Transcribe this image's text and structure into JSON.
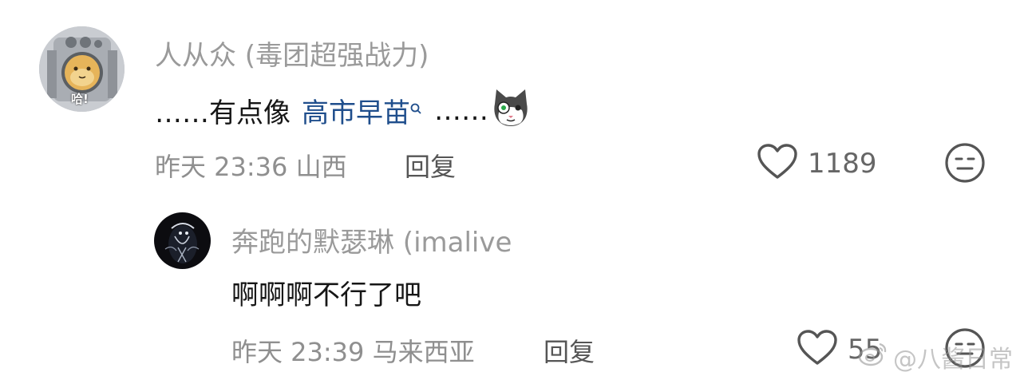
{
  "comment": {
    "username": "人从众 (毒团超强战力)",
    "text_prefix": "……有点像",
    "mention": "高市早苗",
    "text_suffix": "……",
    "avatar_overlay_text": "哈!",
    "time": "昨天 23:36",
    "location": "山西",
    "reply_label": "回复",
    "like_count": "1189"
  },
  "reply": {
    "username": "奔跑的默瑟琳 (imalive",
    "text": "啊啊啊不行了吧",
    "time": "昨天 23:39",
    "location": "马来西亚",
    "reply_label": "回复",
    "like_count": "55"
  },
  "watermark": {
    "text": "@八酱日常"
  },
  "colors": {
    "username": "#9a9a9a",
    "mention": "#1f4e8c",
    "meta": "#8f8f8f"
  },
  "icons": [
    "heart-outline-icon",
    "neutral-face-icon",
    "search-icon",
    "cat-emoji-icon",
    "weibo-icon"
  ]
}
